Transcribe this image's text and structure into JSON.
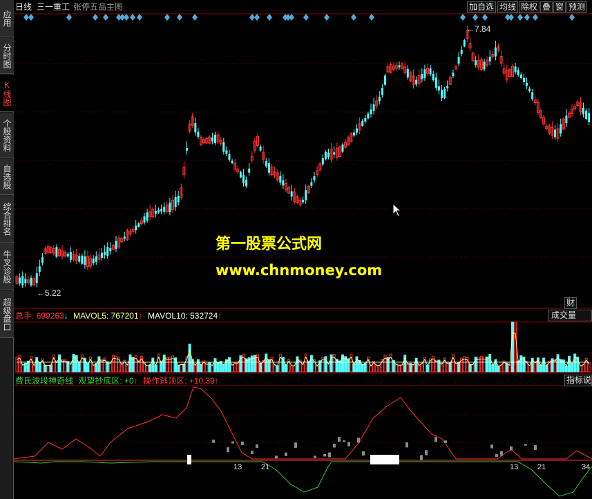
{
  "colors": {
    "up": "#ff3232",
    "down": "#54fcfc",
    "grid": "#7a0000",
    "watermark": "#ffff00",
    "markers": "#4fa8d8"
  },
  "sidebar": {
    "tabs": [
      {
        "label": "应用",
        "active": false
      },
      {
        "label": "分时图",
        "active": false
      },
      {
        "label": "K线图",
        "active": true
      },
      {
        "label": "个股资料",
        "active": false
      },
      {
        "label": "自选股",
        "active": false
      },
      {
        "label": "综合排名",
        "active": false
      },
      {
        "label": "牛叉诊股",
        "active": false
      },
      {
        "label": "超级盘口",
        "active": false
      }
    ]
  },
  "topbar": {
    "period": "日线",
    "stock_name": "三一重工",
    "formula_name": "张停五品主图",
    "buttons": [
      "加自选",
      "均线",
      "除权",
      "叠",
      "窗",
      "预测"
    ]
  },
  "price_chart": {
    "high_label": "7.84",
    "low_label": "5.22",
    "markers_icon": "diamond-marker-icon"
  },
  "watermark": {
    "title": "第一股票公式网",
    "url": "www.chnmoney.com"
  },
  "volume_pane": {
    "label": "总手:",
    "value": "699263",
    "value_arrow": "↓",
    "ma5_label": "MAVOL5:",
    "ma5_value": "767201",
    "ma5_arrow": "↑",
    "ma10_label": "MAVOL10:",
    "ma10_value": "532724",
    "ma10_arrow": "↑",
    "cai_button": "财",
    "name_button": "成交量"
  },
  "indicator_pane": {
    "name": "费氏波段神奇线",
    "line1_label": "观望抄底区:",
    "line1_value": "+0",
    "line1_arrow": "↑",
    "line2_label": "操作逃顶区:",
    "line2_value": "+10.39",
    "line2_arrow": "↑",
    "button": "指标说",
    "fib_labels": [
      "13",
      "21",
      "13",
      "21",
      "34"
    ]
  }
}
